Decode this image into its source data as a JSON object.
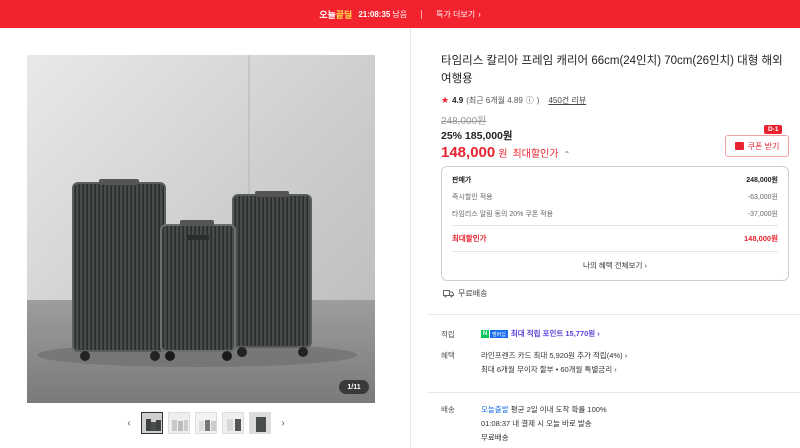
{
  "topbar": {
    "logo_part1": "오늘",
    "logo_part2": "끝딜",
    "timer": "21:08:35",
    "timer_suffix": "남음",
    "more_label": "특가 더보기",
    "chevron": "›"
  },
  "gallery": {
    "counter": "1/11",
    "prev_arrow": "‹",
    "next_arrow": "›",
    "thumbnail_count": 5
  },
  "product": {
    "title": "타임리스 칼리아 프레임 캐리어 66cm(24인치) 70cm(26인치) 대형 해외 여행용",
    "rating": "4.9",
    "rating_recent": "(최근 6개월 4.89",
    "rating_info": "ⓘ",
    "rating_close": ")",
    "review_count": "450건 리뷰",
    "original_price": "248,000원",
    "discount_line": "25% 185,000원",
    "final_price": "148,000",
    "final_won": "원",
    "final_label": "최대할인가",
    "final_chev": "⌃"
  },
  "coupon": {
    "label": "쿠폰 받기",
    "badge": "D-1"
  },
  "price_box": {
    "rows": [
      {
        "label": "판매가",
        "value": "248,000원"
      },
      {
        "label": "즉시할인 적용",
        "value": "-63,000원"
      },
      {
        "label": "타임리스 알림 동의 20% 쿠폰 적용",
        "value": "-37,000원"
      }
    ],
    "total_label": "최대할인가",
    "total_value": "148,000원",
    "benefit_link": "나의 혜택 전체보기 ›"
  },
  "shipping_free": "무료배송",
  "accrual": {
    "label": "적립",
    "npay_badge": "N",
    "membership_badge": "멤버십",
    "text": "최대 적립 포인트 15,770원 ›"
  },
  "benefits": {
    "label": "혜택",
    "line1": "라인프렌즈 카드 최대 5,920원 추가 적립(4%) ›",
    "line2": "최대 6개월 무이자 할부 • 60개월 특별금리 ›"
  },
  "delivery": {
    "label": "배송",
    "tomorrow": "오늘출발",
    "line1_rest": "평균 2일 이내 도착 확률 100%",
    "line2": "01:08:37  내 결제 시 오늘 바로 발송",
    "line3": "무료배송"
  },
  "colors": {
    "accent": "#f2232f",
    "price_red": "#e8232f",
    "violet": "#5a44d8",
    "naver_green": "#03c75a"
  },
  "icons": [
    "chevron-right-icon",
    "star-icon",
    "coupon-icon",
    "truck-icon",
    "info-icon",
    "chevron-left-icon"
  ]
}
